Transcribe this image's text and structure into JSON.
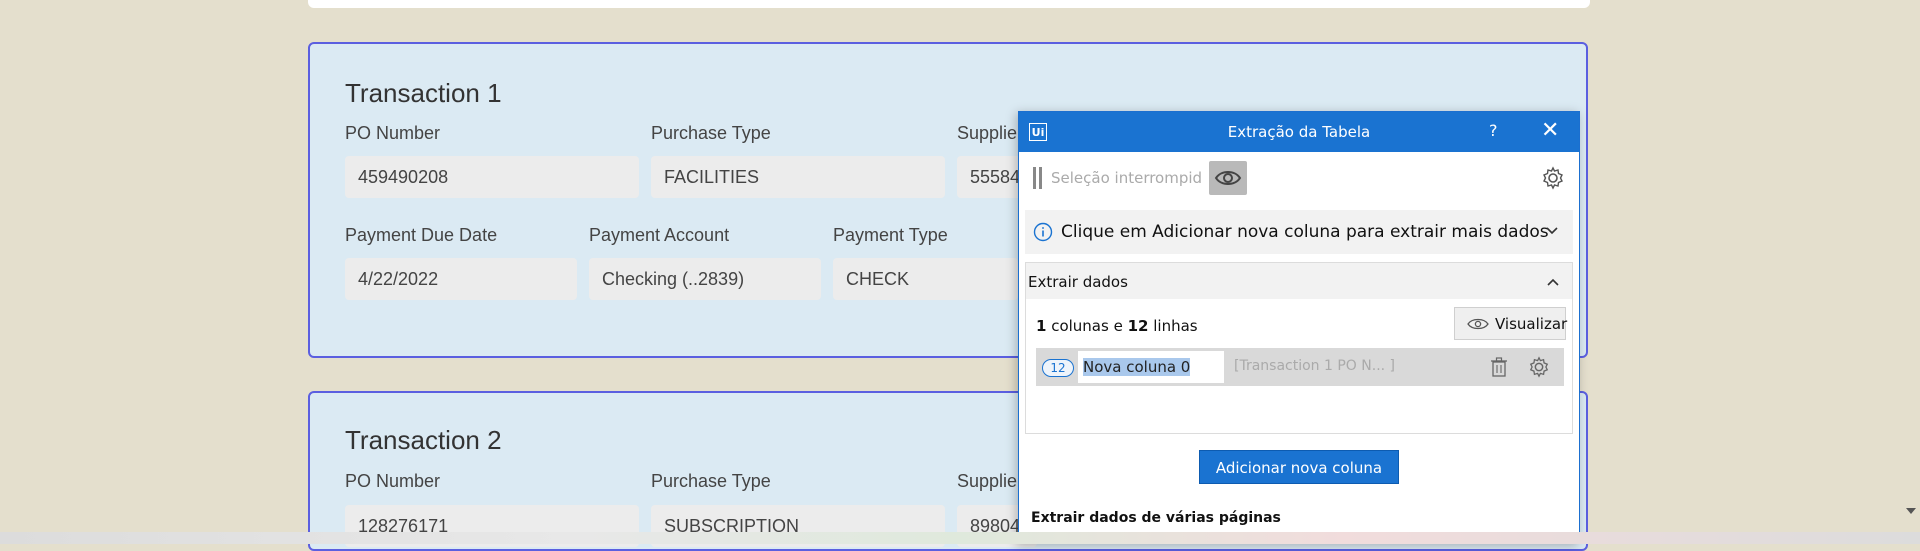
{
  "transactions": [
    {
      "title": "Transaction 1",
      "labels": {
        "po": "PO Number",
        "purchase_type": "Purchase Type",
        "supplier": "Supplier",
        "due_date": "Payment Due Date",
        "account": "Payment Account",
        "payment_type": "Payment Type"
      },
      "values": {
        "po": "459490208",
        "purchase_type": "FACILITIES",
        "supplier": "55584",
        "due_date": "4/22/2022",
        "account": "Checking (..2839)",
        "payment_type": "CHECK"
      }
    },
    {
      "title": "Transaction 2",
      "labels": {
        "po": "PO Number",
        "purchase_type": "Purchase Type",
        "supplier": "Supplier"
      },
      "values": {
        "po": "128276171",
        "purchase_type": "SUBSCRIPTION",
        "supplier": "89804"
      }
    }
  ],
  "dialog": {
    "logo": "Ui",
    "title": "Extração da Tabela",
    "help": "?",
    "close": "✕",
    "toolbar": {
      "status_placeholder": "Seleção interrompida"
    },
    "info": "Clique em Adicionar nova coluna para extrair mais dados",
    "extract": {
      "header": "Extrair dados",
      "columns_count": "1",
      "columns_word": " colunas e ",
      "rows_count": "12",
      "rows_word": " linhas",
      "preview_label": "Visualizar",
      "column": {
        "badge": "12",
        "name": "Nova coluna 0",
        "preview": "[Transaction 1 PO N... ]"
      }
    },
    "add_column_label": "Adicionar nova coluna",
    "multi_page_label": "Extrair dados de várias páginas"
  },
  "colors": {
    "accent": "#1a73d1",
    "card_border": "#5b5fe0",
    "card_bg": "#dbeaf3",
    "page_bg": "#e4dfcd"
  }
}
